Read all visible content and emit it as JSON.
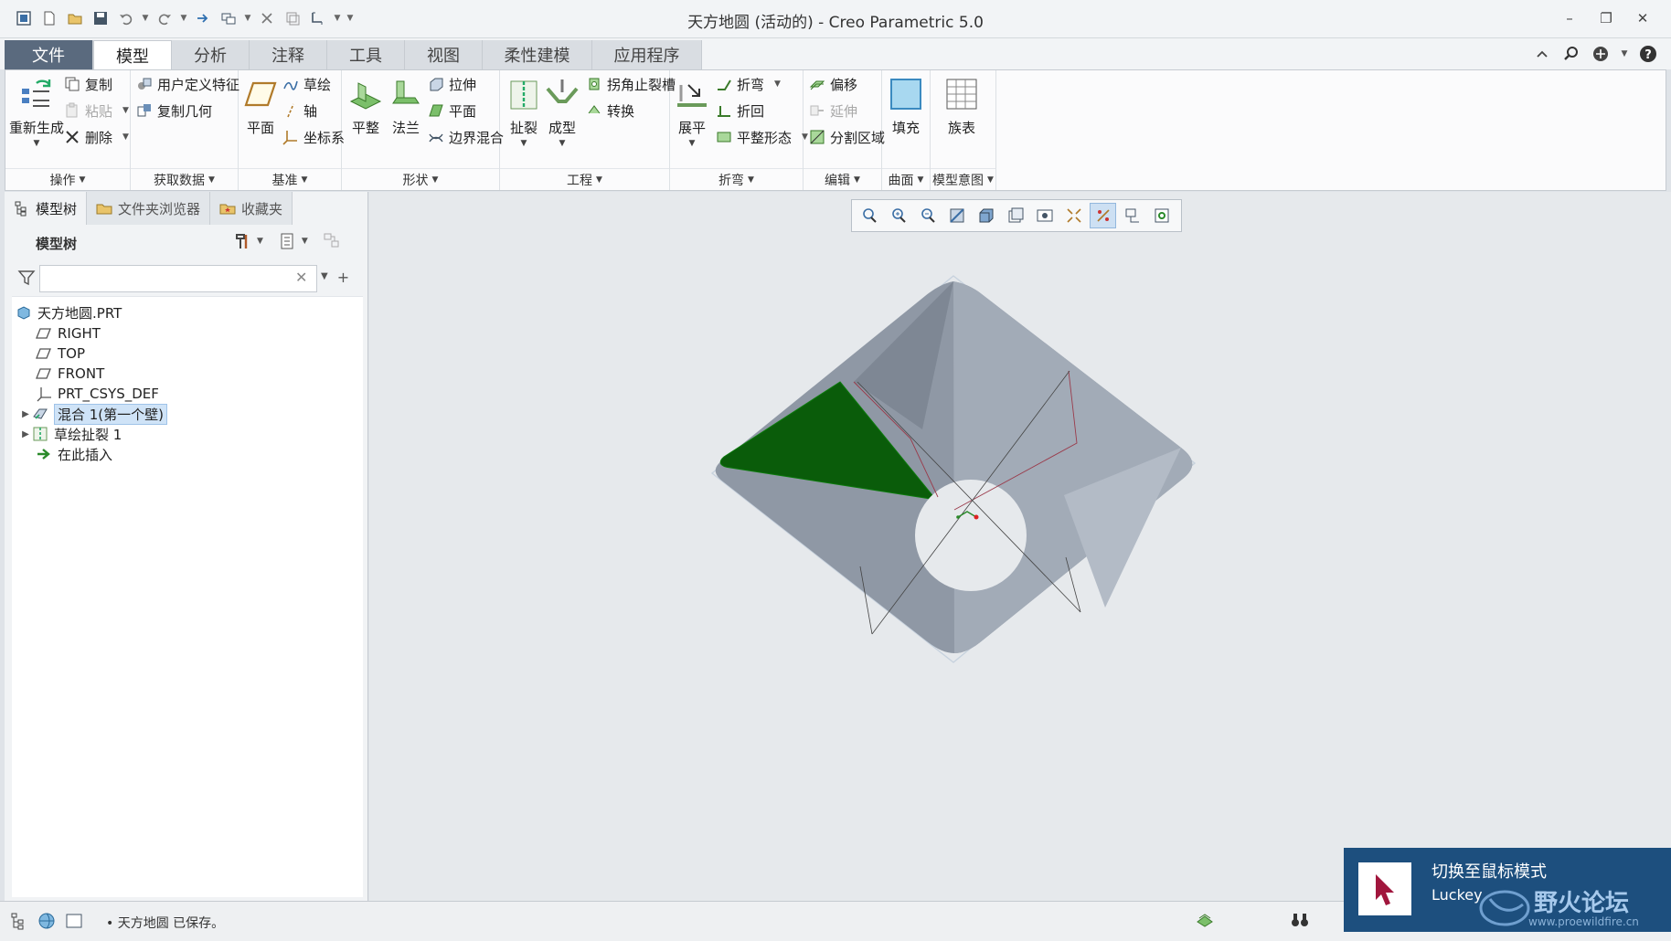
{
  "window": {
    "title": "天方地圆 (活动的) - Creo Parametric 5.0",
    "controls": [
      "–",
      "❐",
      "✕"
    ]
  },
  "tabs": [
    "文件",
    "模型",
    "分析",
    "注释",
    "工具",
    "视图",
    "柔性建模",
    "应用程序"
  ],
  "ribbon": {
    "operations": {
      "label": "操作",
      "regenerate": "重新生成",
      "copy": "复制",
      "paste": "粘贴",
      "delete": "删除"
    },
    "get_data": {
      "label": "获取数据",
      "udf": "用户定义特征",
      "copy_geom": "复制几何"
    },
    "datum": {
      "label": "基准",
      "plane": "平面",
      "sketch": "草绘",
      "axis": "轴",
      "csys": "坐标系"
    },
    "shapes": {
      "label": "形状",
      "flat": "平整",
      "flange": "法兰",
      "extrude": "拉伸",
      "planar": "平面",
      "boundary_blend": "边界混合"
    },
    "engineering": {
      "label": "工程",
      "rip": "扯裂",
      "form": "成型",
      "corner_relief": "拐角止裂槽",
      "convert": "转换"
    },
    "bends": {
      "label": "折弯",
      "unbend": "展平",
      "bend": "折弯",
      "bend_back": "折回",
      "flat_state": "平整形态"
    },
    "editing": {
      "label": "编辑",
      "offset": "偏移",
      "extend": "延伸",
      "split_area": "分割区域"
    },
    "surfaces": {
      "label": "曲面",
      "fill": "填充"
    },
    "model_intent": {
      "label": "模型意图",
      "family_table": "族表"
    }
  },
  "panel": {
    "tabs": [
      "模型树",
      "文件夹浏览器",
      "收藏夹"
    ],
    "tree_title": "模型树",
    "search": {
      "value": "",
      "placeholder": ""
    },
    "items": [
      {
        "label": "天方地圆.PRT",
        "icon": "part-icon",
        "level": 0,
        "expandable": false
      },
      {
        "label": "RIGHT",
        "icon": "datum-plane-icon",
        "level": 1,
        "expandable": false
      },
      {
        "label": "TOP",
        "icon": "datum-plane-icon",
        "level": 1,
        "expandable": false
      },
      {
        "label": "FRONT",
        "icon": "datum-plane-icon",
        "level": 1,
        "expandable": false
      },
      {
        "label": "PRT_CSYS_DEF",
        "icon": "csys-icon",
        "level": 1,
        "expandable": false
      },
      {
        "label": "混合 1(第一个壁)",
        "icon": "blend-wall-icon",
        "level": 1,
        "expandable": true,
        "selected": true
      },
      {
        "label": "草绘扯裂 1",
        "icon": "sketch-rip-icon",
        "level": 1,
        "expandable": true
      },
      {
        "label": "在此插入",
        "icon": "insert-here-icon",
        "level": 1,
        "expandable": false
      }
    ]
  },
  "status": {
    "message": "天方地圆 已保存。"
  },
  "notice": {
    "title": "切换至鼠标模式",
    "subtitle": "Luckey",
    "forum": "野火论坛",
    "url": "www.proewildfire.cn"
  },
  "colors": {
    "file_tab": "#5a6a7e",
    "selected_face": "#0a5c0a",
    "model_surface": "#8a93a0",
    "notice_bg": "#1d4f7e"
  }
}
